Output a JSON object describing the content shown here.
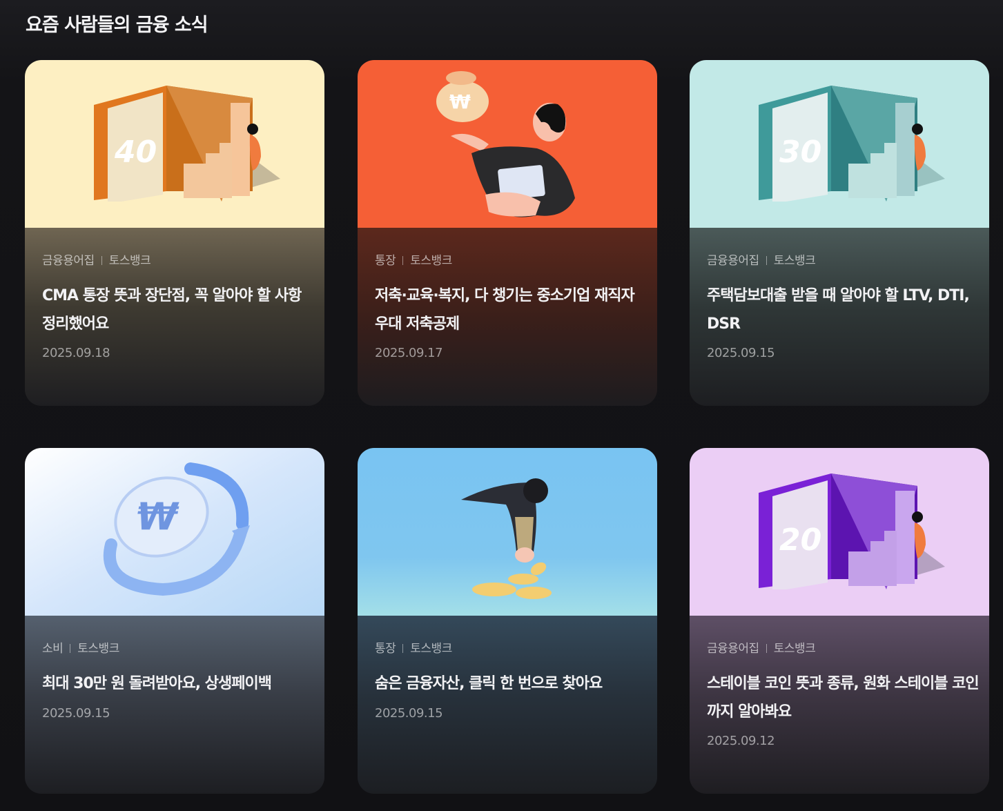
{
  "section": {
    "title": "요즘 사람들의 금융 소식"
  },
  "colors": {
    "card1_thumb": "#fdefc2",
    "card2_thumb": "#f55f36",
    "card3_thumb": "#c2e9e7",
    "card4_thumb": "#d9e9fb",
    "card5_thumb": "#7ec8f2",
    "card6_thumb": "#ebcef5"
  },
  "cards": [
    {
      "illustration": "book-stairs-orange",
      "badge_number": "40",
      "category": "금융용어집",
      "source": "토스뱅크",
      "title": "CMA 통장 뜻과 장단점, 꼭 알아야 할 사항 정리했어요",
      "date": "2025.09.18"
    },
    {
      "illustration": "person-money-bag",
      "category": "통장",
      "source": "토스뱅크",
      "title": "저축·교육·복지, 다 챙기는 중소기업 재직자 우대 저축공제",
      "date": "2025.09.17"
    },
    {
      "illustration": "book-stairs-teal",
      "badge_number": "30",
      "category": "금융용어집",
      "source": "토스뱅크",
      "title": "주택담보대출 받을 때 알아야 할 LTV, DTI, DSR",
      "date": "2025.09.15"
    },
    {
      "illustration": "won-coin-cycle",
      "category": "소비",
      "source": "토스뱅크",
      "title": "최대 30만 원 돌려받아요, 상생페이백",
      "date": "2025.09.15"
    },
    {
      "illustration": "person-picking-coins",
      "category": "통장",
      "source": "토스뱅크",
      "title": "숨은 금융자산, 클릭 한 번으로 찾아요",
      "date": "2025.09.15"
    },
    {
      "illustration": "book-stairs-purple",
      "badge_number": "20",
      "category": "금융용어집",
      "source": "토스뱅크",
      "title": "스테이블 코인 뜻과 종류, 원화 스테이블 코인까지 알아봐요",
      "date": "2025.09.12"
    }
  ]
}
